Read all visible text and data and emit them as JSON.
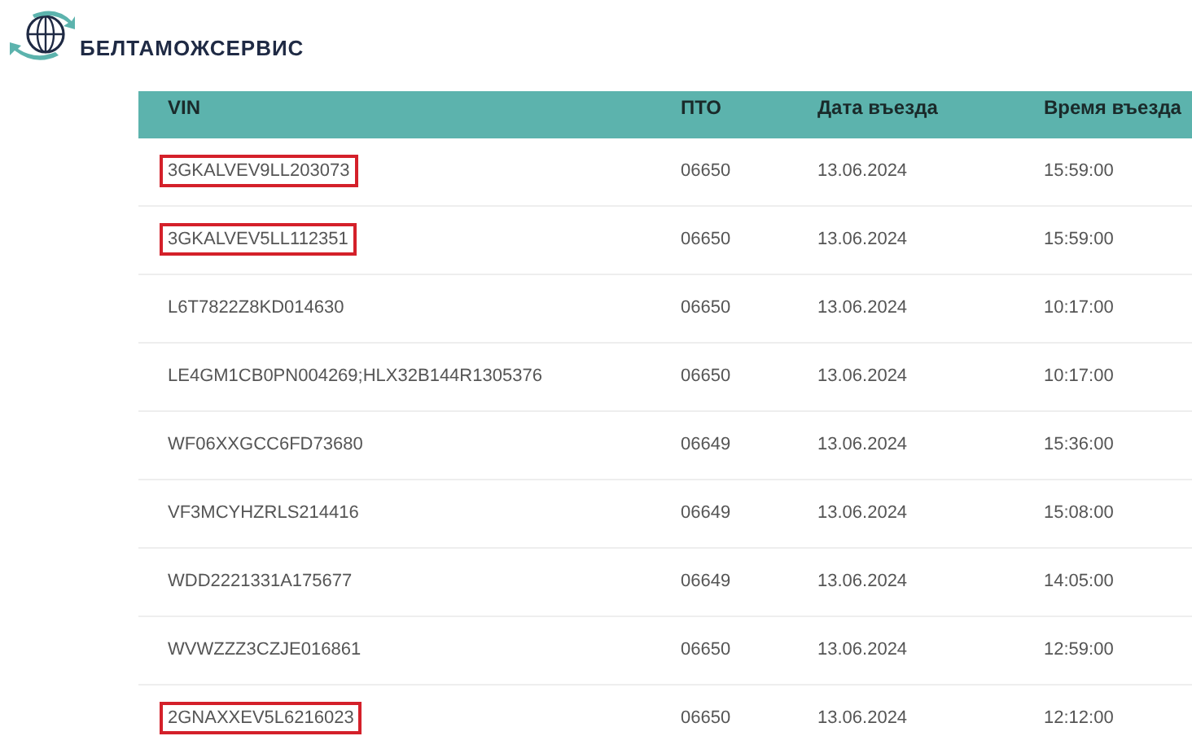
{
  "logo": {
    "text": "БЕЛТАМОЖСЕРВИС"
  },
  "table": {
    "columns": [
      "VIN",
      "ПТО",
      "Дата въезда",
      "Время въезда"
    ],
    "rows": [
      {
        "vin": "3GKALVEV9LL203073",
        "pto": "06650",
        "date": "13.06.2024",
        "time": "15:59:00",
        "highlighted": true
      },
      {
        "vin": "3GKALVEV5LL112351",
        "pto": "06650",
        "date": "13.06.2024",
        "time": "15:59:00",
        "highlighted": true
      },
      {
        "vin": "L6T7822Z8KD014630",
        "pto": "06650",
        "date": "13.06.2024",
        "time": "10:17:00",
        "highlighted": false
      },
      {
        "vin": "LE4GM1CB0PN004269;HLX32B144R1305376",
        "pto": "06650",
        "date": "13.06.2024",
        "time": "10:17:00",
        "highlighted": false
      },
      {
        "vin": "WF06XXGCC6FD73680",
        "pto": "06649",
        "date": "13.06.2024",
        "time": "15:36:00",
        "highlighted": false
      },
      {
        "vin": "VF3MCYHZRLS214416",
        "pto": "06649",
        "date": "13.06.2024",
        "time": "15:08:00",
        "highlighted": false
      },
      {
        "vin": "WDD2221331A175677",
        "pto": "06649",
        "date": "13.06.2024",
        "time": "14:05:00",
        "highlighted": false
      },
      {
        "vin": "WVWZZZ3CZJE016861",
        "pto": "06650",
        "date": "13.06.2024",
        "time": "12:59:00",
        "highlighted": false
      },
      {
        "vin": "2GNAXXEV5L6216023",
        "pto": "06650",
        "date": "13.06.2024",
        "time": "12:12:00",
        "highlighted": true
      }
    ]
  }
}
